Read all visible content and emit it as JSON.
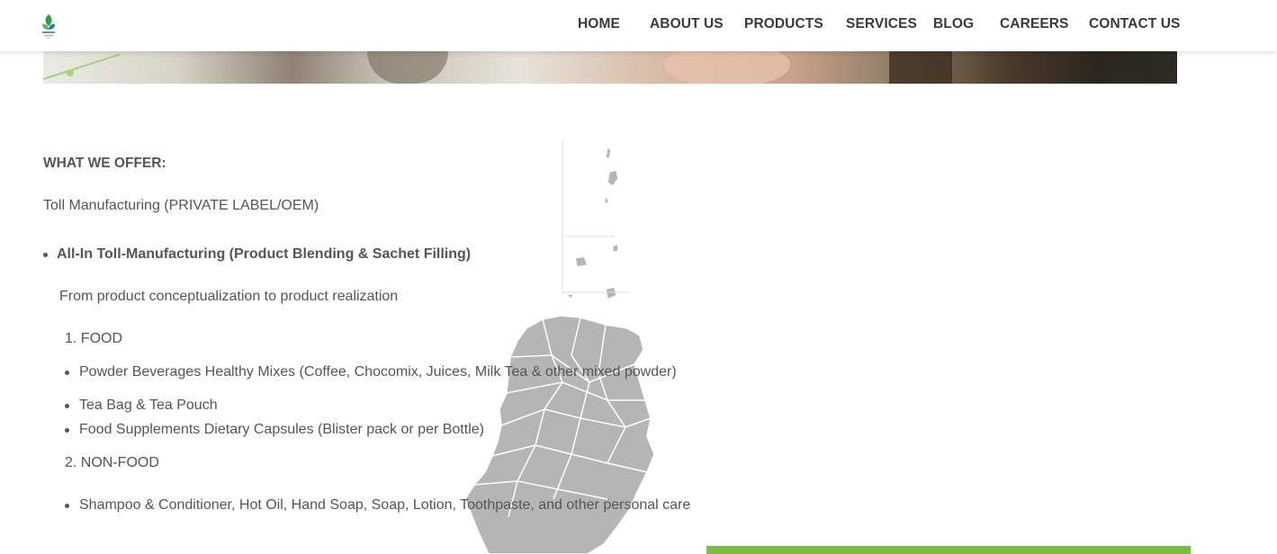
{
  "header": {
    "logo_icon": "company-leaf-logo-icon",
    "nav": [
      {
        "label": "HOME"
      },
      {
        "label": "ABOUT US"
      },
      {
        "label": "PRODUCTS"
      },
      {
        "label": "SERVICES"
      },
      {
        "label": "BLOG"
      },
      {
        "label": "CAREERS"
      },
      {
        "label": "CONTACT US"
      }
    ]
  },
  "content": {
    "heading": "WHAT WE OFFER:",
    "subheading": "Toll Manufacturing (PRIVATE LABEL/OEM)",
    "service_title": "All-In Toll-Manufacturing (Product Blending & Sachet Filling)",
    "service_desc": "From product conceptualization to product realization",
    "categories": [
      {
        "label": "1. FOOD",
        "items": [
          "Powder Beverages Healthy Mixes (Coffee, Chocomix, Juices, Milk Tea & other mixed powder)",
          "Tea Bag & Tea Pouch",
          "Food Supplements Dietary Capsules (Blister pack or per Bottle)"
        ]
      },
      {
        "label": "2. NON-FOOD",
        "items": [
          "Shampoo & Conditioner, Hot Oil, Hand Soap, Soap, Lotion, Toothpaste, and other personal care"
        ]
      }
    ]
  },
  "colors": {
    "accent_green": "#79bd43",
    "text": "#555555",
    "nav_text": "#3a3a3a",
    "map_gray": "#b3b3b3"
  },
  "background_icon": "philippines-map-watermark"
}
